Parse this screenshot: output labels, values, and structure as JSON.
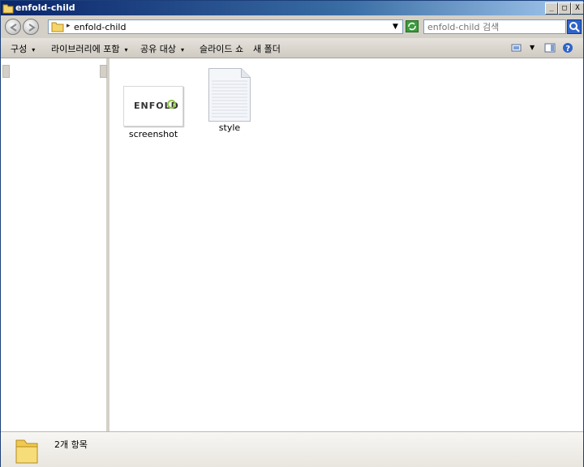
{
  "window": {
    "title": "enfold-child",
    "controls": {
      "minimize": "_",
      "maximize": "□",
      "close": "X"
    }
  },
  "address": {
    "path": "enfold-child",
    "separator": "▸"
  },
  "search": {
    "placeholder": "enfold-child 검색"
  },
  "toolbar": {
    "organize": "구성",
    "include_in_library": "라이브러리에 포함",
    "share_with": "공유 대상",
    "slideshow": "슬라이드 쇼",
    "new_folder": "새 폴더",
    "caret": "▾"
  },
  "files": [
    {
      "name": "screenshot",
      "thumbnail_text": "ENFOLD",
      "accent": "#8cc63f"
    },
    {
      "name": "style"
    }
  ],
  "details": {
    "item_count": "2개 항목"
  }
}
